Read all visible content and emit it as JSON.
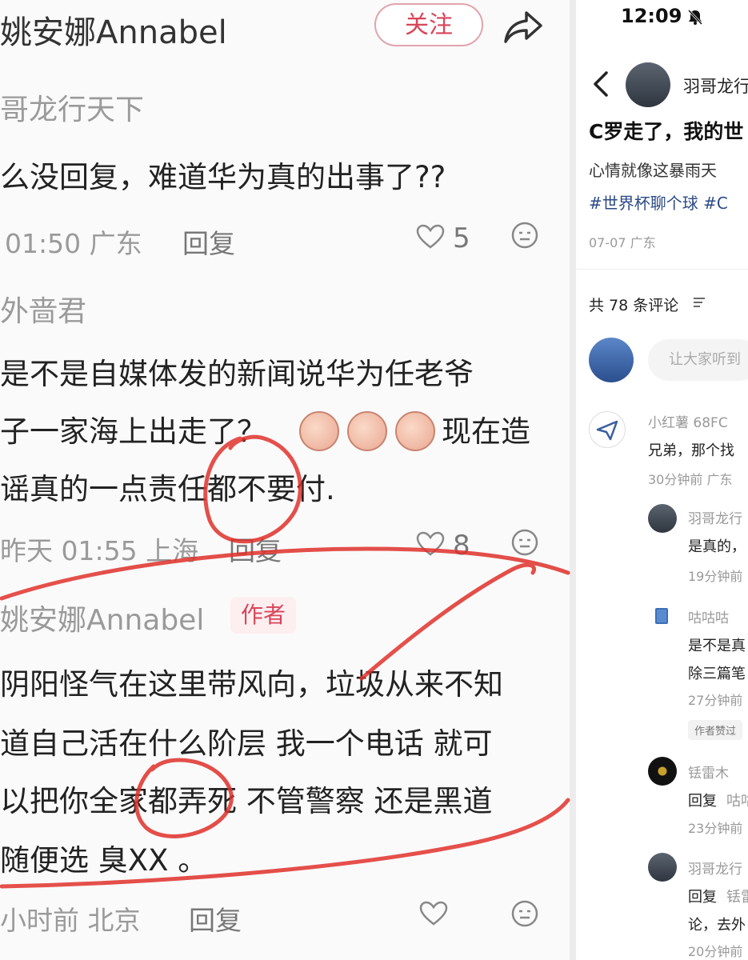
{
  "left": {
    "header": {
      "name": "姚安娜Annabel",
      "follow_label": "关注"
    },
    "comments": [
      {
        "name": "哥龙行天下",
        "text_lines": [
          "么没回复，难道华为真的出事了??"
        ],
        "meta": "01:50 广东",
        "reply": "回复",
        "likes": "5"
      },
      {
        "name": "外啬君",
        "text_lines": [
          "是不是自媒体发的新闻说华为任老爷",
          "子一家海上出走了？",
          "现在造",
          "谣真的一点责任都不要付."
        ],
        "meta": "昨天 01:55 上海",
        "reply": "回复",
        "likes": "8"
      },
      {
        "name": "姚安娜Annabel",
        "badge": "作者",
        "text_lines": [
          "阴阳怪气在这里带风向，垃圾从来不知",
          "道自己活在什么阶层  我一个电话  就可",
          "以把你全家都弄死  不管警察  还是黑道",
          "随便选 臭XX 。"
        ],
        "meta": "小时前 北京",
        "reply": "回复"
      }
    ]
  },
  "right": {
    "status_time": "12:09",
    "author_name": "羽哥龙行",
    "post_title": "C罗走了，我的世",
    "post_body": "心情就像这暴雨天",
    "hashtags": "#世界杯聊个球 #C",
    "post_meta": "07-07 广东",
    "comment_count": "共 78 条评论",
    "comment_placeholder": "让大家听到",
    "comments": [
      {
        "name": "小红薯 68FC",
        "text": "兄弟，那个找",
        "meta": "30分钟前 广东"
      },
      {
        "name": "羽哥龙行",
        "text": "是真的，",
        "meta": "19分钟前"
      },
      {
        "name": "咕咕咕",
        "text": "是不是真",
        "text2": "除三篇笔",
        "meta": "27分钟前",
        "tag": "作者赞过"
      },
      {
        "name": "铥雷木",
        "text_prefix": "回复",
        "text_mention": "咕咕",
        "meta": "23分钟前"
      },
      {
        "name": "羽哥龙行",
        "text_prefix": "回复",
        "text_mention": "铥雷",
        "text2": "论，去外",
        "meta": "20分钟前"
      }
    ]
  },
  "colors": {
    "accent": "#d8455a",
    "annotation": "#e0312b",
    "hashtag": "#2b4a86"
  }
}
